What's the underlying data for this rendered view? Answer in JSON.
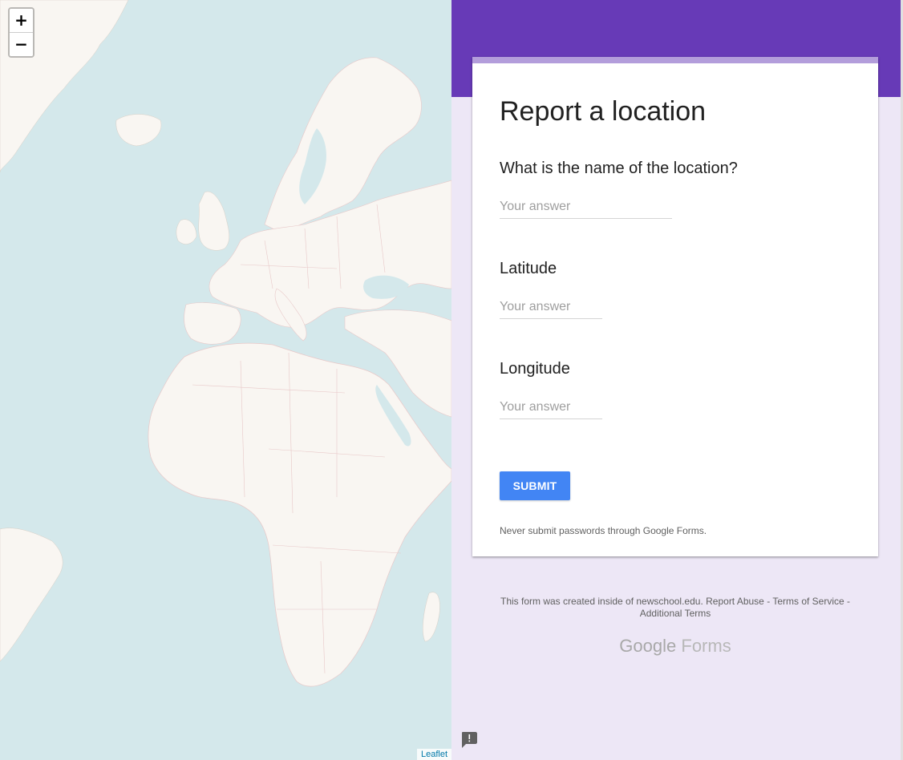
{
  "map": {
    "zoom_in_label": "+",
    "zoom_out_label": "−",
    "attribution": "Leaflet",
    "colors": {
      "water": "#d4e8eb",
      "land": "#f9f6f2",
      "borders": "#e8c8c8"
    }
  },
  "form": {
    "header_color": "#673ab7",
    "background_color": "#ede7f6",
    "title": "Report a location",
    "questions": [
      {
        "label": "What is the name of the location?",
        "placeholder": "Your answer"
      },
      {
        "label": "Latitude",
        "placeholder": "Your answer"
      },
      {
        "label": "Longitude",
        "placeholder": "Your answer"
      }
    ],
    "submit_label": "SUBMIT",
    "submit_color": "#4285f4",
    "warning": "Never submit passwords through Google Forms."
  },
  "footer": {
    "created_text": "This form was created inside of newschool.edu.",
    "report_abuse": "Report Abuse",
    "sep1": "-",
    "terms": "Terms of Service",
    "sep2": "-",
    "additional": "Additional Terms",
    "brand_google": "Google",
    "brand_forms": "Forms"
  },
  "feedback_icon": "feedback-icon"
}
